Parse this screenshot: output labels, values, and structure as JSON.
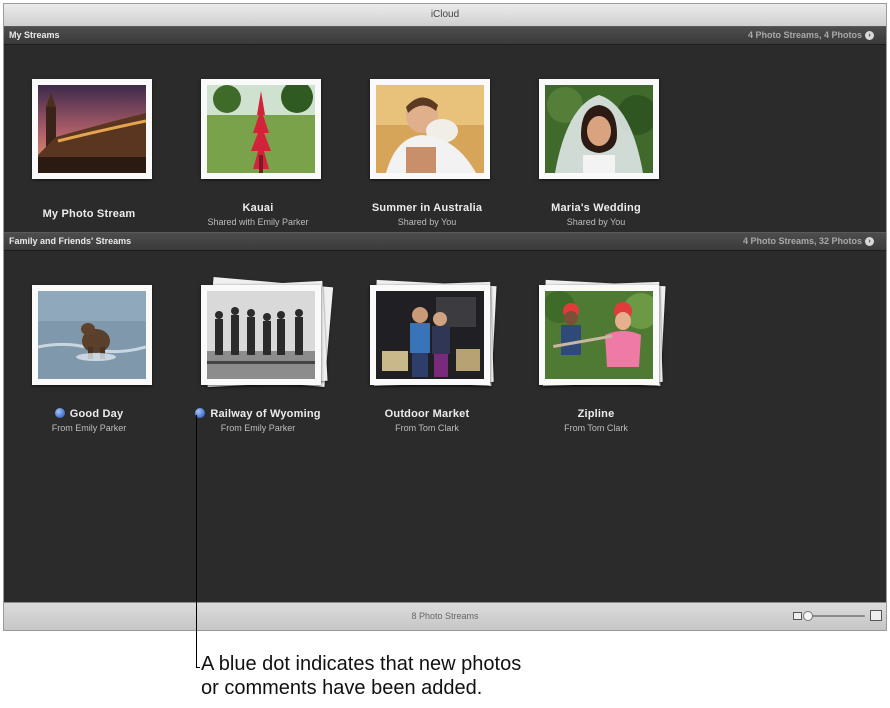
{
  "window": {
    "title": "iCloud"
  },
  "sections": {
    "my": {
      "title": "My Streams",
      "summary": "4 Photo Streams, 4 Photos"
    },
    "family": {
      "title": "Family and Friends' Streams",
      "summary": "4 Photo Streams, 32 Photos"
    }
  },
  "my_streams": [
    {
      "name": "My Photo Stream",
      "subtitle": ""
    },
    {
      "name": "Kauai",
      "subtitle": "Shared with Emily Parker"
    },
    {
      "name": "Summer in Australia",
      "subtitle": "Shared by You"
    },
    {
      "name": "Maria's Wedding",
      "subtitle": "Shared by You"
    }
  ],
  "family_streams": [
    {
      "name": "Good Day",
      "subtitle": "From Emily Parker",
      "new": true
    },
    {
      "name": "Railway of Wyoming",
      "subtitle": "From Emily Parker",
      "new": true
    },
    {
      "name": "Outdoor Market",
      "subtitle": "From Tom Clark",
      "new": false
    },
    {
      "name": "Zipline",
      "subtitle": "From Tom Clark",
      "new": false
    }
  ],
  "statusbar": {
    "count": "8 Photo Streams"
  },
  "callout": {
    "line1": "A blue dot indicates that new photos",
    "line2": "or comments have been added."
  },
  "colors": {
    "new_dot": "#3f6fd0",
    "window_bg": "#2b2b2b"
  },
  "icons": [
    "arrow-right-circle-icon",
    "small-photo-icon",
    "large-photo-icon"
  ]
}
